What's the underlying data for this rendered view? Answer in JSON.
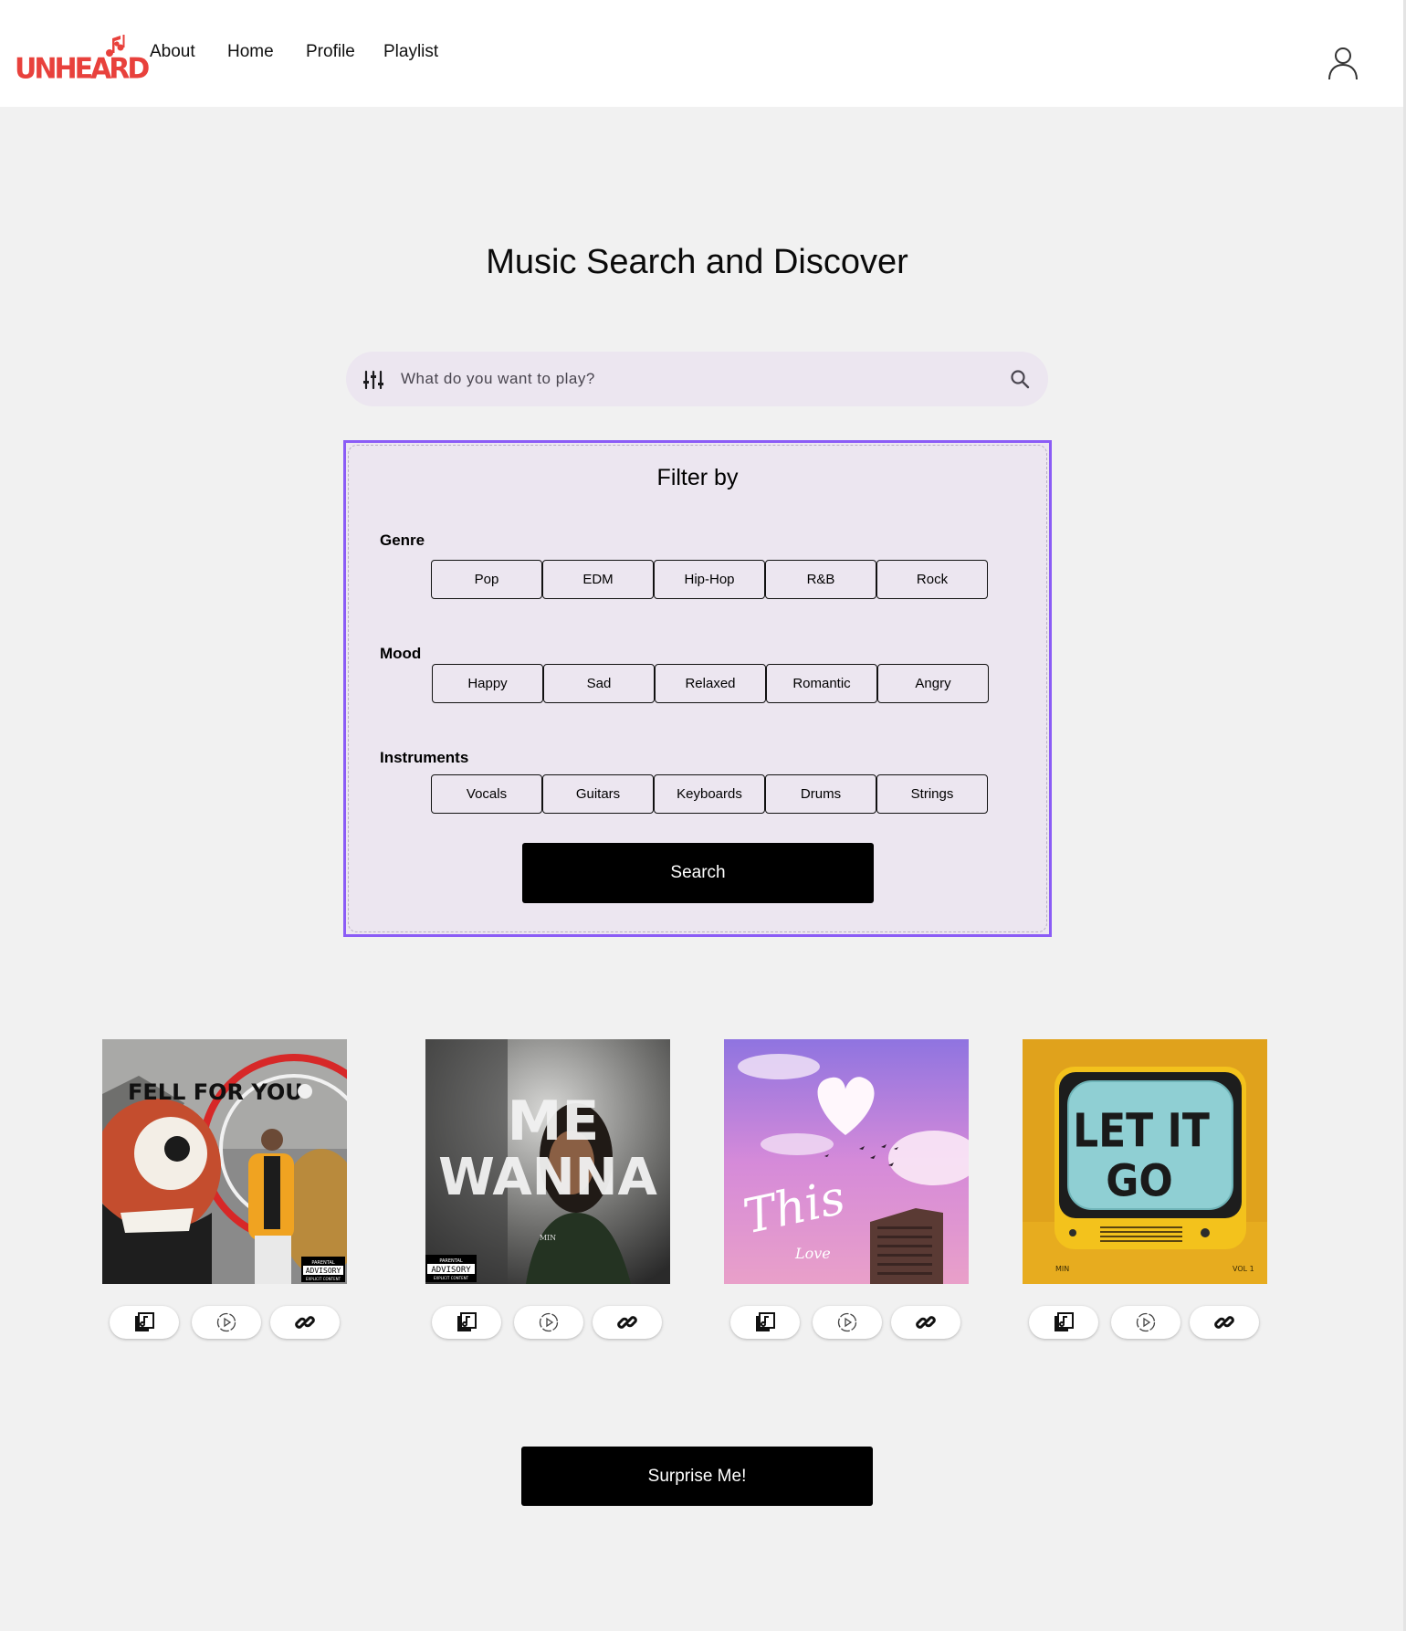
{
  "header": {
    "logo_text": "UNHEARD",
    "nav": [
      "About",
      "Home",
      "Profile",
      "Playlist"
    ]
  },
  "page_title": "Music Search and Discover",
  "search": {
    "placeholder": "What do you want to play?"
  },
  "filters": {
    "title": "Filter by",
    "groups": [
      {
        "label": "Genre",
        "options": [
          "Pop",
          "EDM",
          "Hip-Hop",
          "R&B",
          "Rock"
        ]
      },
      {
        "label": "Mood",
        "options": [
          "Happy",
          "Sad",
          "Relaxed",
          "Romantic",
          "Angry"
        ]
      },
      {
        "label": "Instruments",
        "options": [
          "Vocals",
          "Guitars",
          "Keyboards",
          "Drums",
          "Strings"
        ]
      }
    ],
    "search_button": "Search"
  },
  "albums": [
    {
      "title": "FELL FOR YOU",
      "badge_top": "PARENTAL",
      "badge_mid": "ADVISORY",
      "badge_bottom": "EXPLICIT CONTENT"
    },
    {
      "title_line1": "ME",
      "title_line2": "WANNA",
      "artist": "MIN",
      "badge_top": "PARENTAL",
      "badge_mid": "ADVISORY",
      "badge_bottom": "EXPLICIT CONTENT"
    },
    {
      "title": "This",
      "subtitle": "Love"
    },
    {
      "title_line1": "LET IT",
      "title_line2": "GO",
      "artist": "MIN",
      "volume": "VOL 1"
    }
  ],
  "album_actions": [
    "music-library-icon",
    "play-circle-icon",
    "link-icon"
  ],
  "surprise_button": "Surprise Me!",
  "colors": {
    "brand": "#e8413c",
    "panel": "#ece6f0",
    "panel_border": "#8b5cf6",
    "background": "#f1f1f1"
  }
}
